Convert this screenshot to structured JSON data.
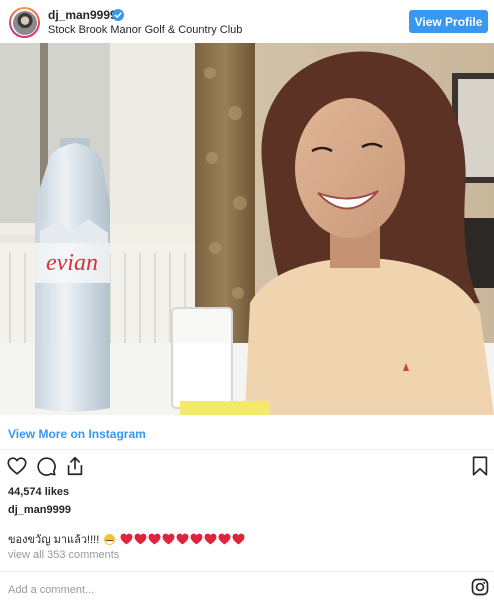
{
  "header": {
    "username": "dj_man9999",
    "location": "Stock Brook Manor Golf & Country Club",
    "view_profile_label": "View Profile",
    "verified_icon": "verified-badge-icon"
  },
  "photo": {
    "bottle_brand": "evian"
  },
  "links": {
    "view_more": "View More on Instagram"
  },
  "actions": {
    "like_icon": "heart-outline-icon",
    "comment_icon": "speech-bubble-icon",
    "share_icon": "share-arrow-icon",
    "save_icon": "bookmark-icon"
  },
  "post": {
    "likes": "44,574 likes",
    "author": "dj_man9999",
    "caption_text": "ของขวัญ มาแล้ว!!!!",
    "caption_emoji": [
      "grinning-face",
      "red-heart",
      "red-heart",
      "red-heart",
      "red-heart",
      "red-heart",
      "red-heart",
      "red-heart",
      "red-heart",
      "red-heart"
    ],
    "comments_link": "view all 353 comments"
  },
  "comment_box": {
    "placeholder": "Add a comment..."
  },
  "colors": {
    "link_blue": "#3897f0",
    "heart_red": "#e0243b",
    "muted_gray": "#999999",
    "text": "#262626"
  }
}
